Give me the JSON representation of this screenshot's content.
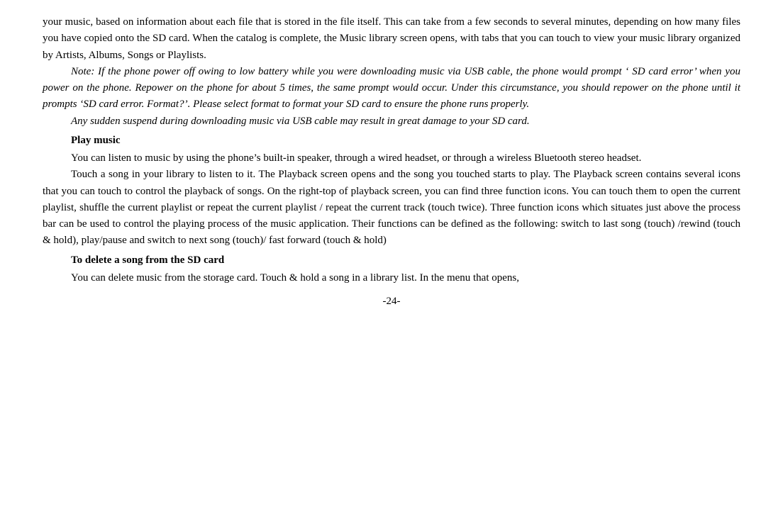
{
  "page": {
    "number": "-24-",
    "content": {
      "opening_paragraph": "your music, based on information about each file that is stored in the file itself. This can take from a few seconds to several minutes, depending on how many files you have copied onto the SD card. When the catalog is complete, the Music library screen opens, with tabs that you can touch to view your music library organized by Artists, Albums, Songs or Playlists.",
      "note_paragraph": "Note: If the phone power off owing to low battery while you were downloading music via USB cable, the phone would prompt ‘ SD card error’ when you power on the phone. Repower on the phone for about 5 times, the same prompt would occur. Under this circumstance, you should repower on the phone until it prompts ‘SD card error. Format?’. Please select format to format your SD card to ensure the phone runs properly.",
      "sudden_suspend_paragraph": "Any sudden suspend during downloading music via USB cable may result in great damage to your SD card.",
      "play_music_heading": "Play music",
      "play_music_paragraph1": "You can listen to music by using the phone’s built-in speaker, through a wired headset, or through a wireless Bluetooth stereo headset.",
      "play_music_paragraph2": "Touch a song in your library to listen to it. The Playback screen opens and the song you touched starts to play. The Playback screen contains several icons that you can touch to control the playback of songs. On the right-top of playback screen, you can find three function icons. You can touch them to open the current playlist, shuffle the current playlist or repeat the current playlist / repeat the current track (touch twice). Three function icons which situates just above the process bar can be used to control the playing process of the music application. Their functions can be defined as the following: switch to last song (touch) /rewind (touch & hold), play/pause and switch to next song (touch)/ fast forward (touch & hold)",
      "delete_heading": "To delete a song from the SD card",
      "delete_paragraph": "You can delete music from the storage card. Touch & hold a song in a library list. In the menu that opens,"
    }
  }
}
